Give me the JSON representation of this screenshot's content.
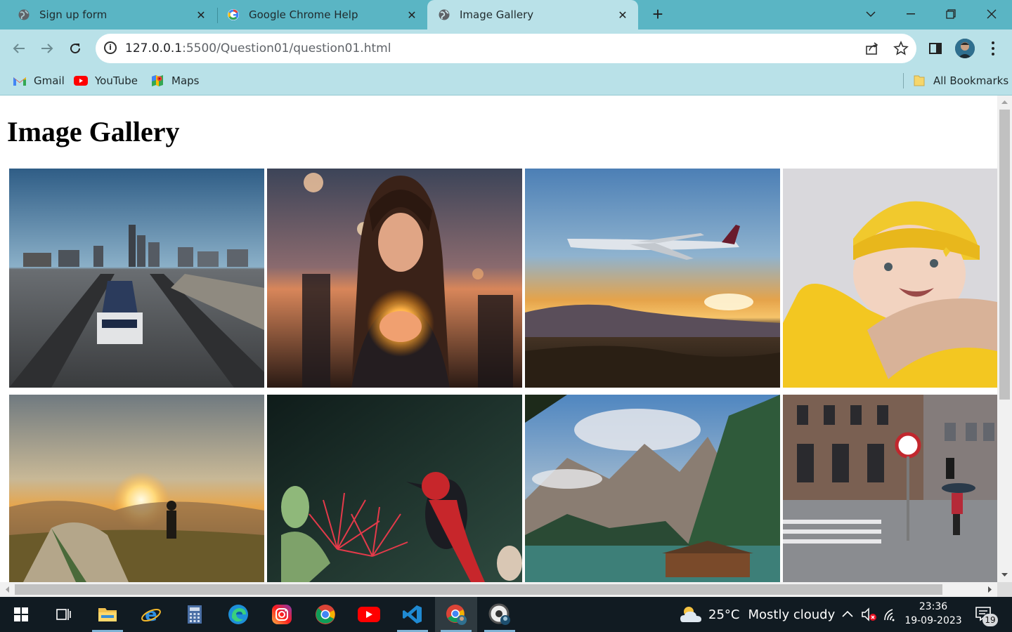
{
  "browser": {
    "tabs": [
      {
        "title": "Sign up form",
        "active": false,
        "favicon": "globe-icon"
      },
      {
        "title": "Google Chrome Help",
        "active": false,
        "favicon": "google-icon"
      },
      {
        "title": "Image Gallery",
        "active": true,
        "favicon": "globe-icon"
      }
    ],
    "address": {
      "host": "127.0.0.1",
      "rest": ":5500/Question01/question01.html"
    },
    "bookmarks": [
      {
        "label": "Gmail",
        "icon": "gmail-icon"
      },
      {
        "label": "YouTube",
        "icon": "youtube-icon"
      },
      {
        "label": "Maps",
        "icon": "maps-icon"
      }
    ],
    "all_bookmarks": "All Bookmarks"
  },
  "page": {
    "heading": "Image Gallery",
    "images": [
      {
        "name": "train-city-photo"
      },
      {
        "name": "girl-lights-photo"
      },
      {
        "name": "airplane-sunset-photo"
      },
      {
        "name": "baby-yellow-photo"
      },
      {
        "name": "tent-sunrise-photo"
      },
      {
        "name": "red-bird-photo"
      },
      {
        "name": "mountain-lake-photo"
      },
      {
        "name": "rainy-street-photo"
      }
    ]
  },
  "taskbar": {
    "apps": [
      "start-icon",
      "task-view-icon",
      "file-explorer-icon",
      "internet-explorer-icon",
      "edge-icon",
      "calculator-icon",
      "instagram-icon",
      "chrome-icon",
      "youtube-app-icon",
      "vscode-icon",
      "chrome-profile-icon",
      "chrome-canary-icon"
    ],
    "weather": {
      "temp": "25°C",
      "condition": "Mostly cloudy"
    },
    "time": "23:36",
    "date": "19-09-2023",
    "notifications": "19"
  },
  "colors": {
    "tab_bar": "#5ab5c4",
    "toolbar": "#b9e1e8",
    "taskbar": "#111b22"
  }
}
